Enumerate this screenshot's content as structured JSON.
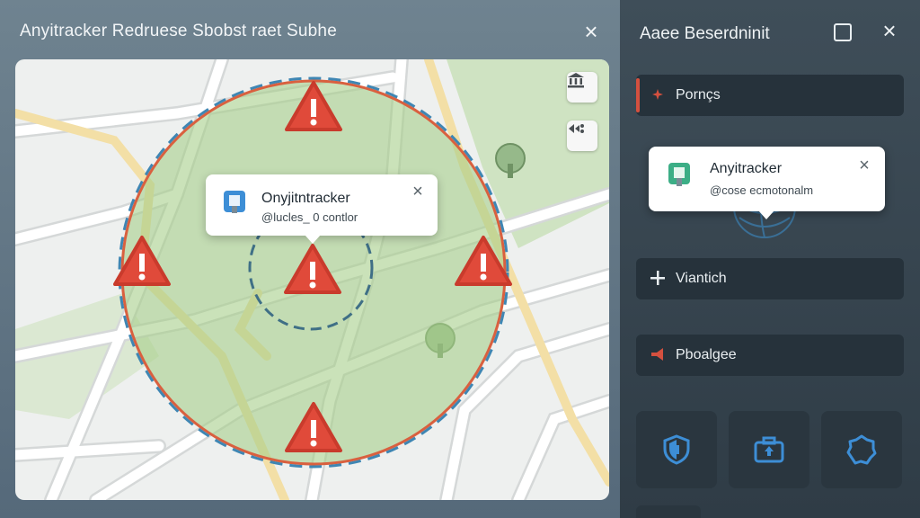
{
  "left_panel": {
    "title": "Anyitracker Redruese Sbobst raet Subhe",
    "close_glyph": "×",
    "map": {
      "zone_color": "#a7cf8b",
      "zone_border_color": "#d9603f",
      "dashed_ring_color": "#3f86b3",
      "alert_color": "#e04a3a",
      "buttons": [
        {
          "icon": "building-icon"
        },
        {
          "icon": "layers-icon"
        }
      ],
      "popup": {
        "title": "Onyjitntracker",
        "subtitle": "@lucles_ 0 contlor",
        "icon": "tracker-device-icon",
        "close_glyph": "×"
      }
    }
  },
  "right_panel": {
    "title": "Aaee Beserdninit",
    "close_glyph": "×",
    "rows": [
      {
        "label": "Pornçs",
        "icon": "sparkle-icon"
      },
      {
        "label": "Viantich",
        "icon": "plus-icon"
      },
      {
        "label": "Pboalgee",
        "icon": "megaphone-icon"
      }
    ],
    "card": {
      "title": "Anyitracker",
      "subtitle": "@cose ecmotonalm",
      "icon": "tracker-device-icon",
      "close_glyph": "×"
    },
    "tiles": [
      {
        "icon": "shield-icon"
      },
      {
        "icon": "medkit-icon"
      },
      {
        "icon": "gear-shape-icon"
      }
    ]
  },
  "colors": {
    "accent_red": "#d4503f",
    "tile_icon_blue": "#3d8ed6"
  }
}
